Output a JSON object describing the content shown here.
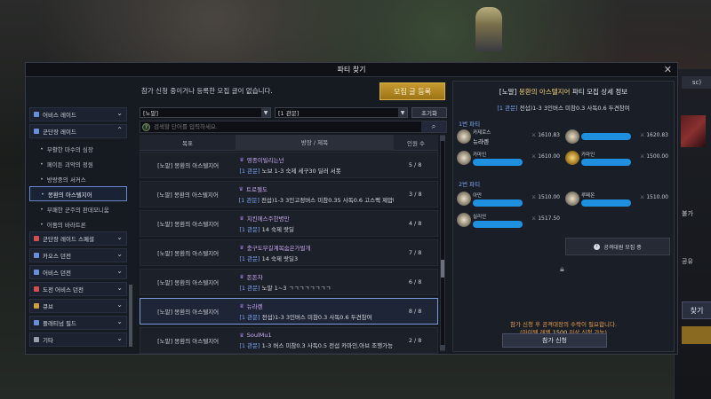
{
  "window": {
    "title": "파티 찾기",
    "info_text": "참가 신청 중이거나 등록한 모집 글이 없습니다.",
    "register_button": "모집 글 등록"
  },
  "sidebar": {
    "categories": [
      {
        "label": "어비스 레이드"
      },
      {
        "label": "군단장 레이드"
      }
    ],
    "subitems": [
      {
        "label": "부활한 마수의 심장"
      },
      {
        "label": "페이튼 괴악의 정원"
      },
      {
        "label": "방랑중의 서커스"
      },
      {
        "label": "몽환의 아스텔지어"
      },
      {
        "label": "부패한 군주의 판데모니움"
      },
      {
        "label": "어둠의 바라트론"
      }
    ],
    "bottom_categories": [
      {
        "label": "군단장 레이드 스페셜"
      },
      {
        "label": "카오스 던전"
      },
      {
        "label": "어비스 던전"
      },
      {
        "label": "도전 어비스 던전"
      },
      {
        "label": "큐브"
      },
      {
        "label": "플래티넘 필드"
      },
      {
        "label": "기타"
      }
    ]
  },
  "filters": {
    "difficulty": "[노말]",
    "gate": "[1 관문]",
    "reset": "초기화",
    "search_placeholder": "검색할 단어를 입력하세요."
  },
  "table": {
    "headers": {
      "target": "목표",
      "title": "방장 / 제목",
      "members": "인원 수"
    },
    "rows": [
      {
        "target": "[노말] 몽환의 아스텔지어",
        "leader": "영종이빌리는넌",
        "tag": "[1 관문]",
        "title": "노브 1-3 숙제 세구30 딜러 서폿",
        "count": "5 / 8"
      },
      {
        "target": "[노말] 몽환의 아스텔지어",
        "leader": "트로젤도",
        "tag": "[1 관문]",
        "title": "전섭)1-3 3인고정버스 미참0.35 사독0.6 고스펙 제압빠름",
        "count": "3 / 8"
      },
      {
        "target": "[노말] 몽환의 아스텔지어",
        "leader": "치킨에스주한병만",
        "tag": "[1 관문]",
        "title": "14 숙제 랏딜",
        "count": "4 / 8"
      },
      {
        "target": "[노말] 몽환의 아스텔지어",
        "leader": "충구도무길계목숨은가벌개",
        "tag": "[1 관문]",
        "title": "14 숙제 랏딜3",
        "count": "7 / 8"
      },
      {
        "target": "[노말] 몽환의 아스텔지어",
        "leader": "돈돈차",
        "tag": "[1 관문]",
        "title": "노말 1~3 ㄱㄱㄱㄱㄱㄱㄱㄱ",
        "count": "6 / 8"
      },
      {
        "target": "[노말] 몽환의 아스텔지어",
        "leader": "뉴라렌",
        "tag": "[1 관문]",
        "title": "전섭)1-3 3인버스 미참0.3 사독0.6 두견참여",
        "count": "8 / 8"
      },
      {
        "target": "[노말] 몽환의 아스텔지어",
        "leader": "SoulMu1",
        "tag": "[1 관문]",
        "title": "1-3 버스 미참0.3 사독0.5 전섭 카마인,아브 조행가능",
        "count": "2 / 8"
      }
    ]
  },
  "detail": {
    "title_tag": "[노말]",
    "title_name": "몽환의 아스텔지어",
    "title_rest": "파티 모집 상세 정보",
    "sub_tag": "[1 관문]",
    "sub_text": "전섭)1-3 3인버스 미참0.3 사독0.6 두견참여",
    "party1_label": "1번 파티",
    "party2_label": "2번 파티",
    "members": [
      {
        "class": "카제로스",
        "name": "뉴라렌",
        "ilvl": "1610.83"
      },
      {
        "class": "",
        "name": "",
        "ilvl": "1620.83"
      },
      {
        "class": "카마인",
        "name": "",
        "ilvl": "1610.00"
      },
      {
        "class": "카마인",
        "name": "",
        "ilvl": "1500.00"
      },
      {
        "class": "아만",
        "name": "",
        "ilvl": "1510.00"
      },
      {
        "class": "루페온",
        "name": "",
        "ilvl": "1510.00"
      },
      {
        "class": "실리안",
        "name": "",
        "ilvl": "1517.50"
      }
    ],
    "recruit_text": "공격대원 모집 중",
    "notice_line1": "참가 신청 후 공격대장의 수락이 필요합니다.",
    "notice_line2_pre": "(아이템 레벨 ",
    "notice_level": "1500",
    "notice_line2_post": " 이상 신청 가능)",
    "apply_button": "참가 신청"
  },
  "background": {
    "right_sc": "sc)",
    "right_btn": "찾기",
    "right_text1": "불가",
    "right_text2": "공유"
  },
  "colors": {
    "accent_gold": "#c79a2e",
    "highlight_blue": "#7ea4f0",
    "name_purple": "#c9a8f0",
    "notice_orange": "#e8a050",
    "redaction_blue": "#1f8fe0"
  }
}
